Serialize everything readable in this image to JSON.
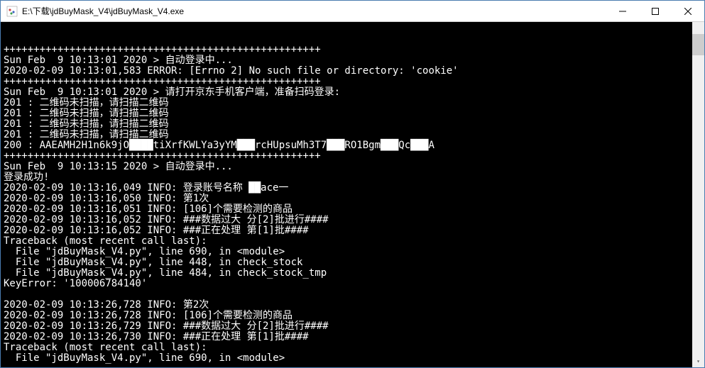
{
  "window": {
    "title": "E:\\下载\\jdBuyMask_V4\\jdBuyMask_V4.exe"
  },
  "console": {
    "lines": [
      "+++++++++++++++++++++++++++++++++++++++++++++++++++++",
      "Sun Feb  9 10:13:01 2020 > 自动登录中...",
      "2020-02-09 10:13:01,583 ERROR: [Errno 2] No such file or directory: 'cookie'",
      "+++++++++++++++++++++++++++++++++++++++++++++++++++++",
      "Sun Feb  9 10:13:01 2020 > 请打开京东手机客户端，准备扫码登录:",
      "201 : 二维码未扫描，请扫描二维码",
      "201 : 二维码未扫描，请扫描二维码",
      "201 : 二维码未扫描，请扫描二维码",
      "201 : 二维码未扫描，请扫描二维码",
      "200 : AAEAMH2H1n6k9jO████tiXrfKWLYa3yYM███rcHUpsuMh3T7███RO1Bgm███Qc███A",
      "+++++++++++++++++++++++++++++++++++++++++++++++++++++",
      "Sun Feb  9 10:13:15 2020 > 自动登录中...",
      "登录成功!",
      "2020-02-09 10:13:16,049 INFO: 登录账号名称 ██ace一",
      "2020-02-09 10:13:16,050 INFO: 第1次",
      "2020-02-09 10:13:16,051 INFO: [106]个需要检测的商品",
      "2020-02-09 10:13:16,052 INFO: ###数据过大 分[2]批进行####",
      "2020-02-09 10:13:16,052 INFO: ###正在处理 第[1]批####",
      "Traceback (most recent call last):",
      "  File \"jdBuyMask_V4.py\", line 690, in <module>",
      "  File \"jdBuyMask_V4.py\", line 448, in check_stock",
      "  File \"jdBuyMask_V4.py\", line 484, in check_stock_tmp",
      "KeyError: '100006784140'",
      "",
      "2020-02-09 10:13:26,728 INFO: 第2次",
      "2020-02-09 10:13:26,728 INFO: [106]个需要检测的商品",
      "2020-02-09 10:13:26,729 INFO: ###数据过大 分[2]批进行####",
      "2020-02-09 10:13:26,730 INFO: ###正在处理 第[1]批####",
      "Traceback (most recent call last):",
      "  File \"jdBuyMask_V4.py\", line 690, in <module>"
    ]
  }
}
